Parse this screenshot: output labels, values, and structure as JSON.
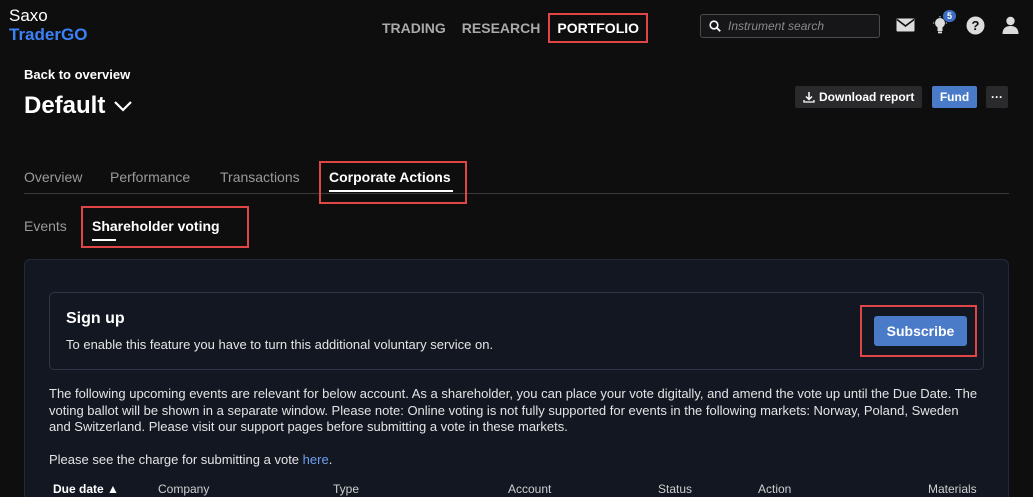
{
  "brand": {
    "line1": "Saxo",
    "line2": "TraderGO"
  },
  "topnav": {
    "trading": "TRADING",
    "research": "RESEARCH",
    "portfolio": "PORTFOLIO"
  },
  "search": {
    "placeholder": "Instrument search"
  },
  "notifications": {
    "count": "5"
  },
  "account": {
    "back": "Back to overview",
    "name": "Default"
  },
  "actions": {
    "download": "Download report",
    "fund": "Fund",
    "more": "···"
  },
  "tabs": [
    "Overview",
    "Performance",
    "Transactions",
    "Corporate Actions"
  ],
  "subtabs": [
    "Events",
    "Shareholder voting"
  ],
  "signup": {
    "title": "Sign up",
    "description": "To enable this feature you have to turn this additional voluntary service on.",
    "button": "Subscribe"
  },
  "info_text": "The following upcoming events are relevant for below account. As a shareholder, you can place your vote digitally, and amend the vote up until the Due Date. The voting ballot will be shown in a separate window. Please note: Online voting is not fully supported for events in the following markets: Norway, Poland, Sweden and Switzerland. Please visit our support pages before submitting a vote in these markets.",
  "charge": {
    "prefix": "Please see the charge for submitting a vote ",
    "link": "here",
    "suffix": "."
  },
  "table": {
    "headers": [
      "Due date ▲",
      "Company",
      "Type",
      "Account",
      "Status",
      "Action",
      "Materials"
    ]
  },
  "colors": {
    "accent": "#4a7bc9",
    "highlight": "#e04646",
    "brand_blue": "#3b82f6"
  }
}
